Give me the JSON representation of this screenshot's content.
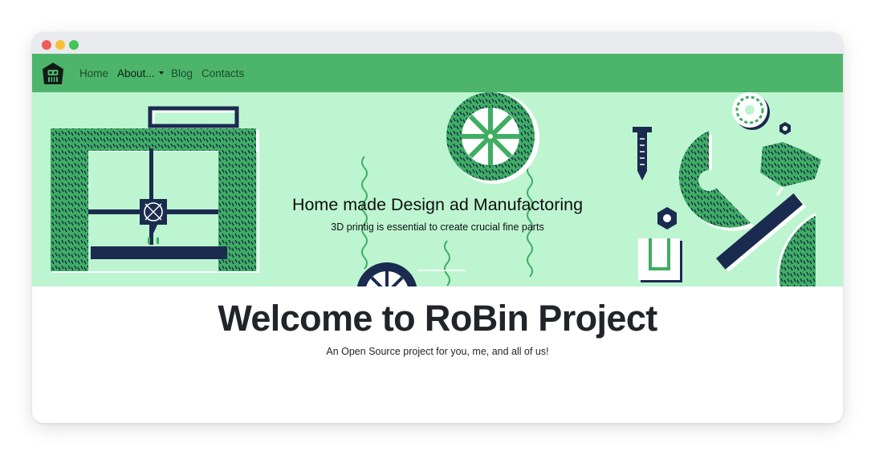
{
  "colors": {
    "navbar": "#4db56b",
    "hero_background": "#bdf5d1",
    "illustration_green": "#3fae63",
    "illustration_navy": "#1b2b4f",
    "text_dark": "#212529"
  },
  "navbar": {
    "logo_icon": "robot-logo-icon",
    "items": [
      {
        "label": "Home"
      },
      {
        "label": "About...",
        "has_dropdown": true,
        "icon": "caret-down-icon"
      },
      {
        "label": "Blog"
      },
      {
        "label": "Contacts"
      }
    ]
  },
  "hero": {
    "title": "Home made Design ad Manufactoring",
    "subtitle": "3D printig is essential to create crucial fine parts",
    "prev_control_icon": "chevron-left-icon",
    "prev_control_glyph": "‹"
  },
  "main": {
    "title": "Welcome to RoBin Project",
    "subtitle": "An Open Source project for you, me, and all of us!"
  }
}
